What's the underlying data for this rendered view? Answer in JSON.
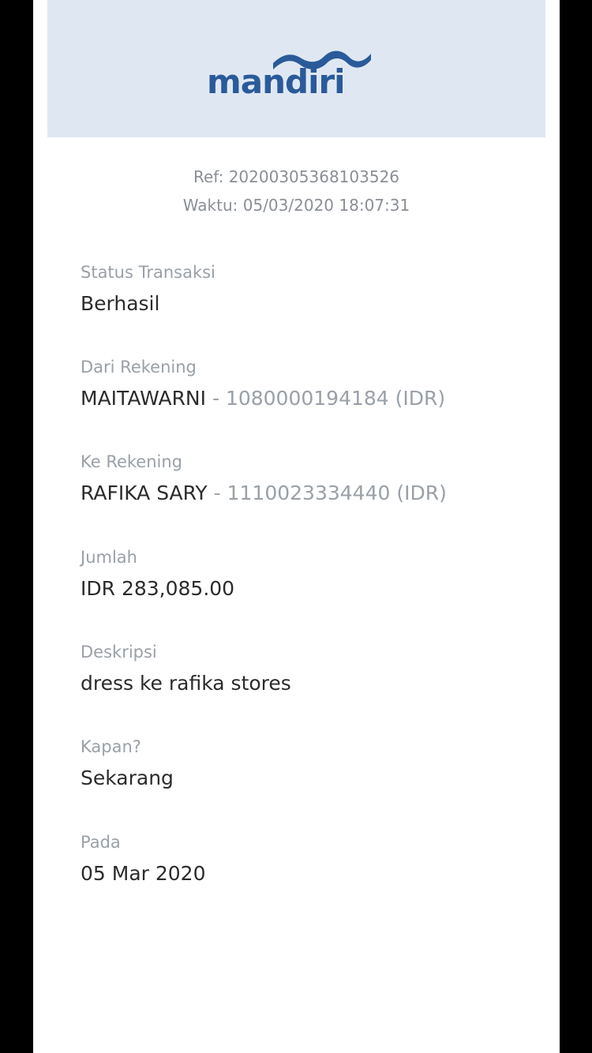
{
  "brand": {
    "logo_text": "mandiri",
    "colors": {
      "header_bg": "#dfe8f2",
      "logo_blue": "#2a5a9a",
      "label_gray": "#9aa0a8",
      "value_dark": "#2b2b2b"
    }
  },
  "meta": {
    "ref": "Ref: 20200305368103526",
    "waktu": "Waktu: 05/03/2020 18:07:31"
  },
  "fields": {
    "status": {
      "label": "Status Transaksi",
      "value": "Berhasil"
    },
    "from_account": {
      "label": "Dari Rekening",
      "name": "MAITAWARNI",
      "separator": " - ",
      "number": "1080000194184 (IDR)"
    },
    "to_account": {
      "label": "Ke Rekening",
      "name": "RAFIKA SARY",
      "separator": " - ",
      "number": "1110023334440 (IDR)"
    },
    "amount": {
      "label": "Jumlah",
      "value": "IDR 283,085.00"
    },
    "description": {
      "label": "Deskripsi",
      "value": "dress ke rafika stores"
    },
    "when": {
      "label": "Kapan?",
      "value": "Sekarang"
    },
    "date": {
      "label": "Pada",
      "value": "05 Mar 2020"
    }
  }
}
